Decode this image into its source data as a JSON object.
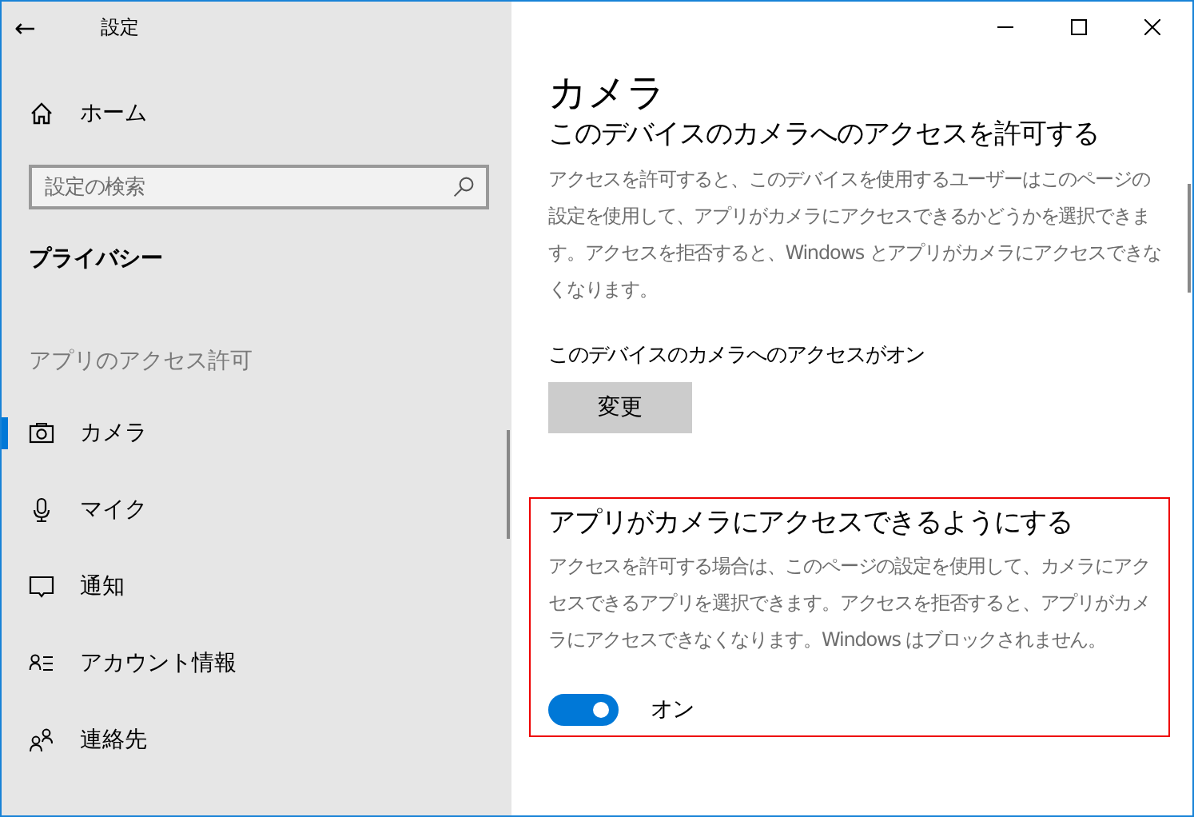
{
  "window": {
    "title": "設定",
    "back": "←"
  },
  "sidebar": {
    "home": "ホーム",
    "search": {
      "placeholder": "設定の検索"
    },
    "category": "プライバシー",
    "section_label": "アプリのアクセス許可",
    "items": [
      {
        "label": "カメラ",
        "kind": "camera",
        "selected": true
      },
      {
        "label": "マイク",
        "kind": "mic",
        "selected": false
      },
      {
        "label": "通知",
        "kind": "notify",
        "selected": false
      },
      {
        "label": "アカウント情報",
        "kind": "account",
        "selected": false
      },
      {
        "label": "連絡先",
        "kind": "contacts",
        "selected": false
      }
    ]
  },
  "content": {
    "title": "カメラ",
    "sections": [
      {
        "kind": "button",
        "heading": "このデバイスのカメラへのアクセスを許可する",
        "description": "アクセスを許可すると、このデバイスを使用するユーザーはこのページの設定を使用して、アプリがカメラにアクセスできるかどうかを選択できます。アクセスを拒否すると、Windows とアプリがカメラにアクセスできなくなります。",
        "status": "このデバイスのカメラへのアクセスがオン",
        "button": "変更",
        "highlighted": false
      },
      {
        "kind": "toggle",
        "heading": "アプリがカメラにアクセスできるようにする",
        "description": "アクセスを許可する場合は、このページの設定を使用して、カメラにアクセスできるアプリを選択できます。アクセスを拒否すると、アプリがカメラにアクセスできなくなります。Windows はブロックされません。",
        "on": true,
        "toggle_label": "オン",
        "highlighted": true
      }
    ]
  }
}
